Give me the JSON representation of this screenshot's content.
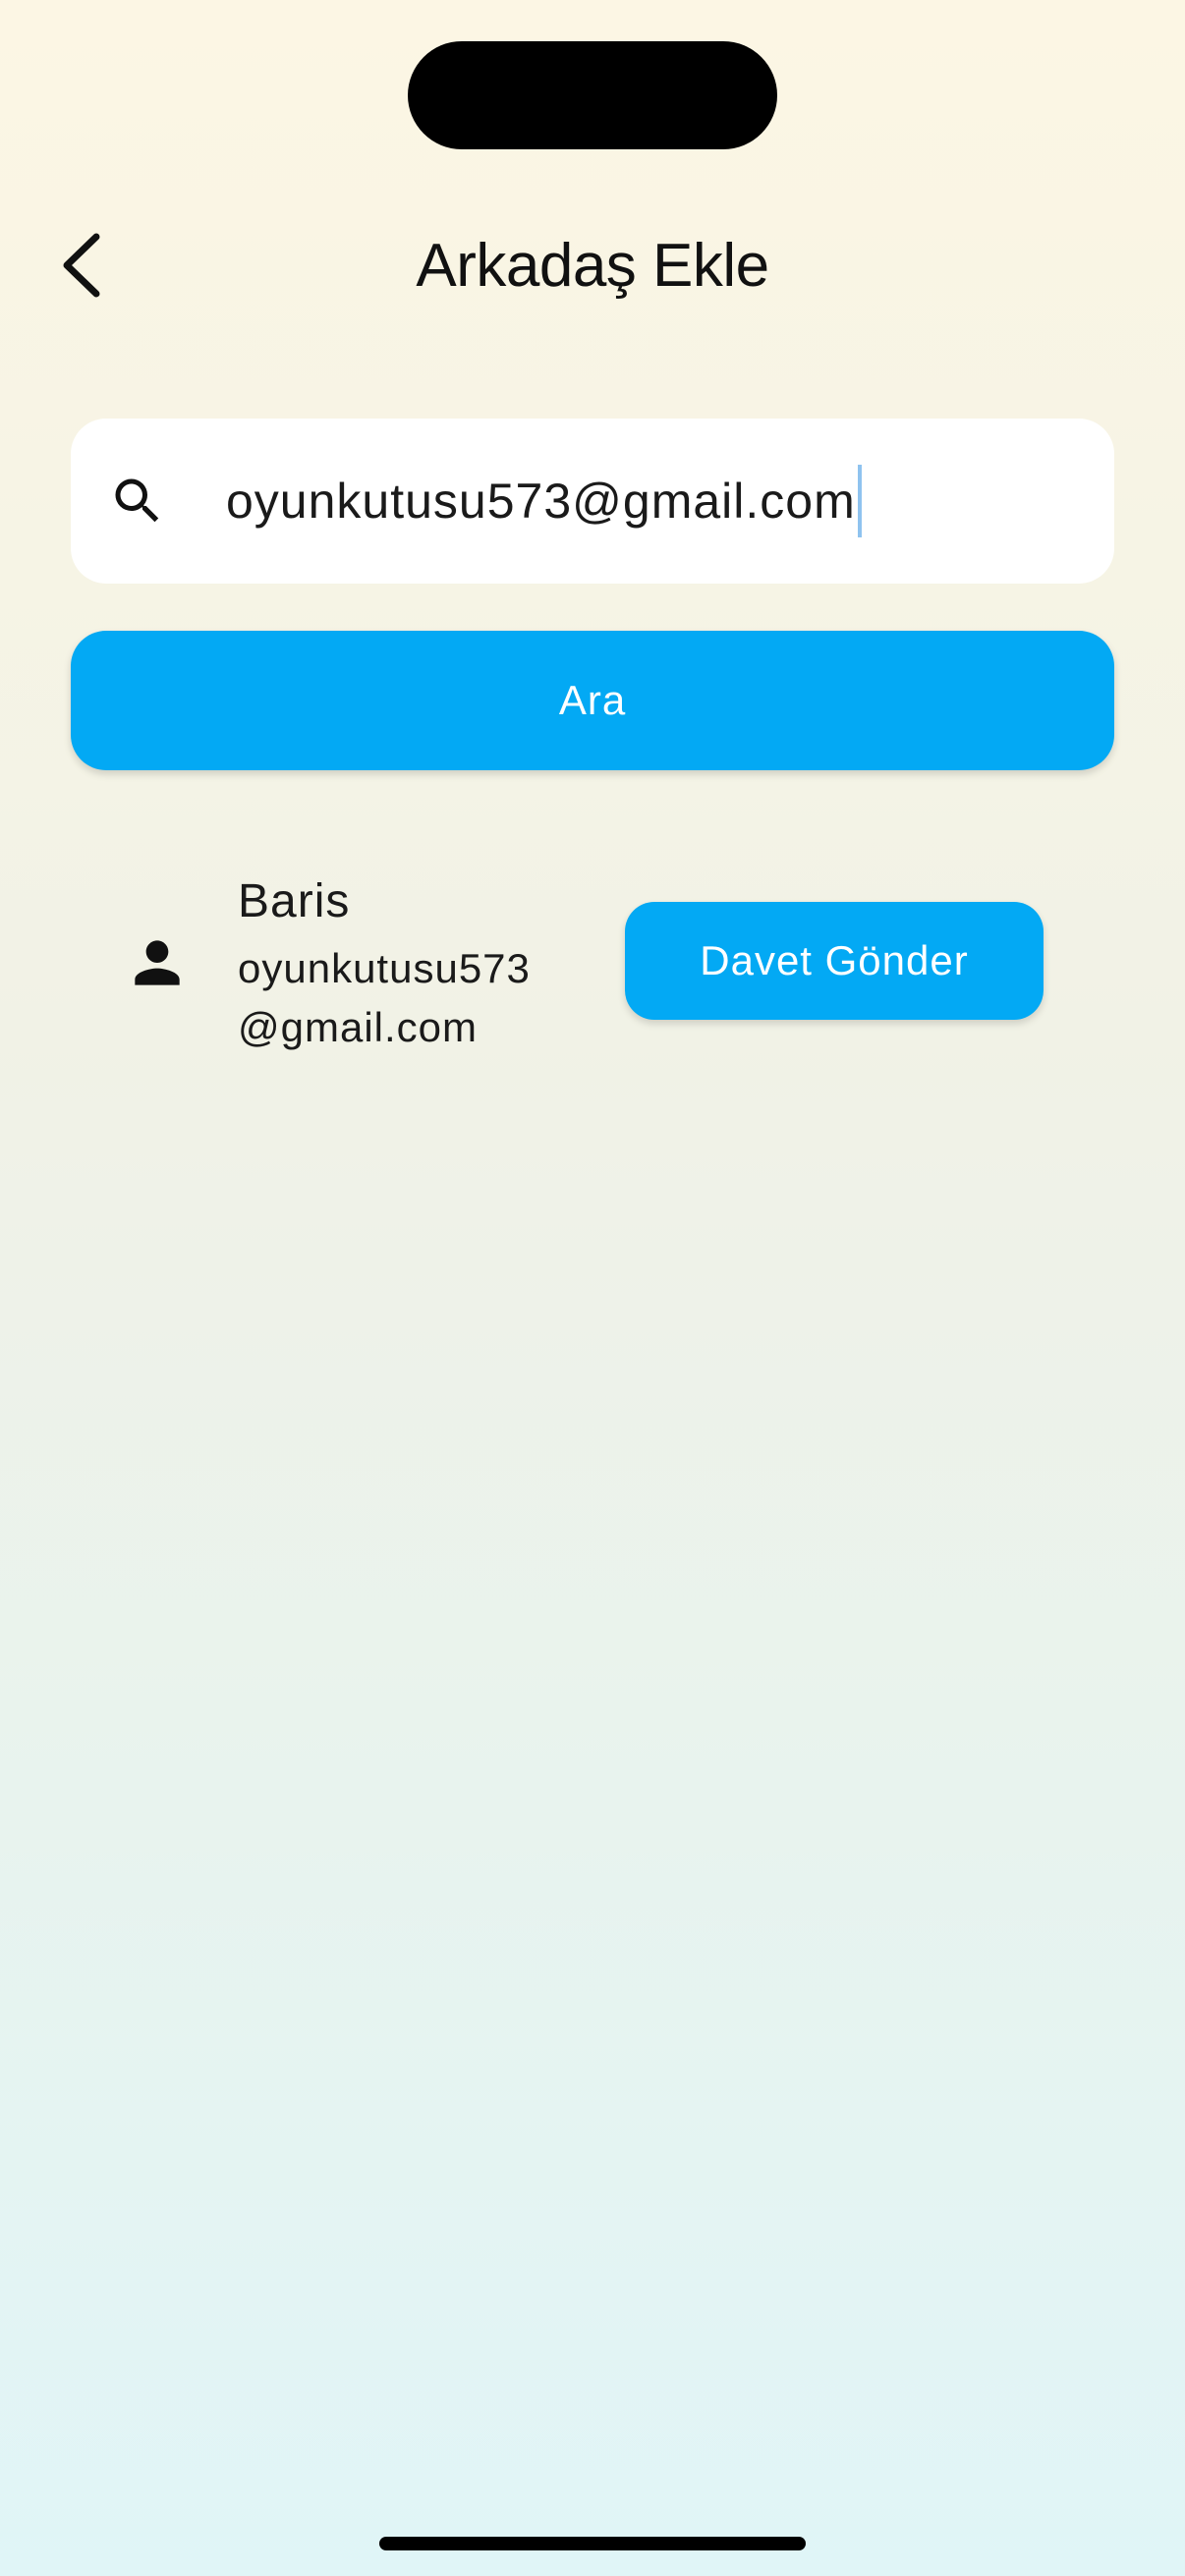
{
  "header": {
    "title": "Arkadaş Ekle",
    "back_icon": "chevron-left-icon"
  },
  "search": {
    "value": "oyunkutusu573@gmail.com",
    "icon": "search-icon",
    "button_label": "Ara"
  },
  "results": [
    {
      "name": "Baris",
      "email": "oyunkutusu573@gmail.com",
      "icon": "person-icon",
      "action_label": "Davet Gönder"
    }
  ],
  "colors": {
    "accent": "#03a9f4",
    "text": "#1a1a1a",
    "caret": "#8fc3ef"
  }
}
